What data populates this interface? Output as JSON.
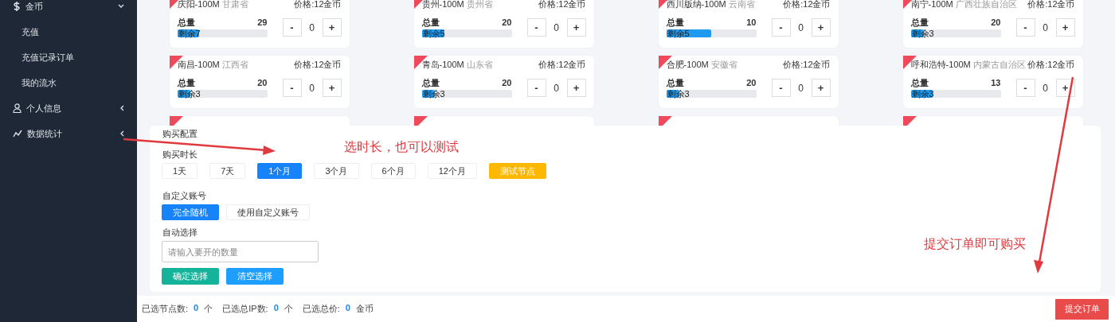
{
  "sidebar": {
    "items": [
      {
        "label": "金币",
        "expanded": true,
        "children": [
          {
            "label": "充值"
          },
          {
            "label": "充值记录订单"
          },
          {
            "label": "我的流水"
          }
        ]
      },
      {
        "label": "个人信息",
        "expanded": false
      },
      {
        "label": "数据统计",
        "expanded": false
      }
    ]
  },
  "nodes": [
    {
      "kind": "node",
      "city": "庆阳-100M",
      "province": "甘肃省",
      "price": "价格:12金币",
      "total_label": "总量",
      "total": "29",
      "remaining": "剩余7",
      "level": 0.24,
      "minus": "-",
      "quantity": "0",
      "plus": "+"
    },
    {
      "kind": "node",
      "city": "贵州-100M",
      "province": "贵州省",
      "price": "价格:12金币",
      "total_label": "总量",
      "total": "20",
      "remaining": "剩余5",
      "level": 0.25,
      "minus": "-",
      "quantity": "0",
      "plus": "+"
    },
    {
      "kind": "node",
      "city": "西川版纳-100M",
      "province": "云南省",
      "price": "价格:12金币",
      "total_label": "总量",
      "total": "10",
      "remaining": "剩余5",
      "level": 0.5,
      "minus": "-",
      "quantity": "0",
      "plus": "+"
    },
    {
      "kind": "node",
      "city": "南宁-100M",
      "province": "广西壮族自治区",
      "price": "价格:12金币",
      "total_label": "总量",
      "total": "20",
      "remaining": "剩余3",
      "level": 0.15,
      "minus": "-",
      "quantity": "0",
      "plus": "+"
    },
    {
      "kind": "node",
      "city": "南昌-100M",
      "province": "江西省",
      "price": "价格:12金币",
      "total_label": "总量",
      "total": "20",
      "remaining": "剩余3",
      "level": 0.15,
      "minus": "-",
      "quantity": "0",
      "plus": "+"
    },
    {
      "kind": "node",
      "city": "青岛-100M",
      "province": "山东省",
      "price": "价格:12金币",
      "total_label": "总量",
      "total": "20",
      "remaining": "剩余3",
      "level": 0.15,
      "minus": "-",
      "quantity": "0",
      "plus": "+"
    },
    {
      "kind": "node",
      "city": "合肥-100M",
      "province": "安徽省",
      "price": "价格:12金币",
      "total_label": "总量",
      "total": "20",
      "remaining": "剩余3",
      "level": 0.15,
      "minus": "-",
      "quantity": "0",
      "plus": "+"
    },
    {
      "kind": "node",
      "city": "呼和浩特-100M",
      "province": "内蒙古自治区",
      "price": "价格:12金币",
      "total_label": "总量",
      "total": "13",
      "remaining": "剩余3",
      "level": 0.24,
      "minus": "-",
      "quantity": "0",
      "plus": "+"
    },
    {
      "kind": "stub"
    },
    {
      "kind": "stub"
    },
    {
      "kind": "stub"
    },
    {
      "kind": "stub"
    }
  ],
  "purchase": {
    "title": "购买配置",
    "duration_label": "购买时长",
    "durations": [
      {
        "kind": "option",
        "label": "1天",
        "selected": false
      },
      {
        "kind": "option",
        "label": "7天",
        "selected": false
      },
      {
        "kind": "option",
        "label": "1个月",
        "selected": true
      },
      {
        "kind": "option",
        "label": "3个月",
        "selected": false
      },
      {
        "kind": "option",
        "label": "6个月",
        "selected": false
      },
      {
        "kind": "option",
        "label": "12个月",
        "selected": false
      },
      {
        "kind": "test",
        "label": "测试节点"
      }
    ],
    "account_label": "自定义账号",
    "accounts": [
      {
        "label": "完全随机",
        "selected": true
      },
      {
        "label": "使用自定义账号",
        "selected": false
      }
    ],
    "auto_label": "自动选择",
    "auto_input": {
      "placeholder": "请输入要开的数量"
    },
    "actions": [
      {
        "kind": "confirm",
        "label": "确定选择"
      },
      {
        "kind": "clear",
        "label": "清空选择"
      }
    ]
  },
  "footer": {
    "summary": [
      {
        "label": "已选节点数:",
        "value": "0",
        "unit": "个"
      },
      {
        "label": "已选总IP数:",
        "value": "0",
        "unit": "个"
      },
      {
        "label": "已选总价:",
        "value": "0",
        "unit": "金币"
      }
    ],
    "submit": "提交订单"
  },
  "annotations": [
    {
      "text": "选时长，也可以测试"
    },
    {
      "text": "提交订单即可购买"
    }
  ]
}
